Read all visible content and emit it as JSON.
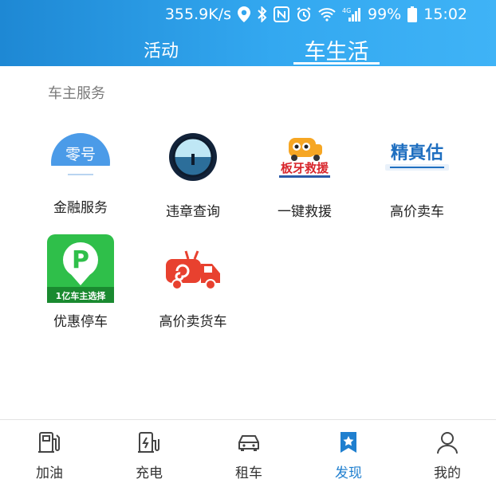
{
  "status_bar": {
    "speed": "355.9K/s",
    "network": "4G",
    "battery": "99%",
    "time": "15:02",
    "icons": [
      "location-icon",
      "bluetooth-icon",
      "nfc-icon",
      "alarm-icon",
      "wifi-icon",
      "signal-icon",
      "battery-icon"
    ]
  },
  "tabs": [
    {
      "label": "活动",
      "selected": false
    },
    {
      "label": "车生活",
      "selected": true
    }
  ],
  "section": {
    "title": "车主服务",
    "items": [
      {
        "label": "金融服务",
        "icon": "zero-logo-icon",
        "logo_text": "零号"
      },
      {
        "label": "违章查询",
        "icon": "violation-query-icon"
      },
      {
        "label": "一键救援",
        "icon": "banya-rescue-icon",
        "logo_text": "板牙救援"
      },
      {
        "label": "高价卖车",
        "icon": "jingzhengu-icon",
        "logo_text": "精真估"
      },
      {
        "label": "优惠停车",
        "icon": "parking-icon",
        "logo_text": "1亿车主选择"
      },
      {
        "label": "高价卖货车",
        "icon": "truck-icon"
      }
    ]
  },
  "bottom_nav": [
    {
      "label": "加油",
      "icon": "fuel-pump-icon",
      "active": false
    },
    {
      "label": "充电",
      "icon": "charger-icon",
      "active": false
    },
    {
      "label": "租车",
      "icon": "car-icon",
      "active": false
    },
    {
      "label": "发现",
      "icon": "discover-bookmark-icon",
      "active": true
    },
    {
      "label": "我的",
      "icon": "profile-icon",
      "active": false
    }
  ],
  "colors": {
    "header_start": "#1e88d4",
    "header_end": "#3fb3f6",
    "active_nav": "#1f7fcf",
    "section_title": "#7a7a7a"
  }
}
